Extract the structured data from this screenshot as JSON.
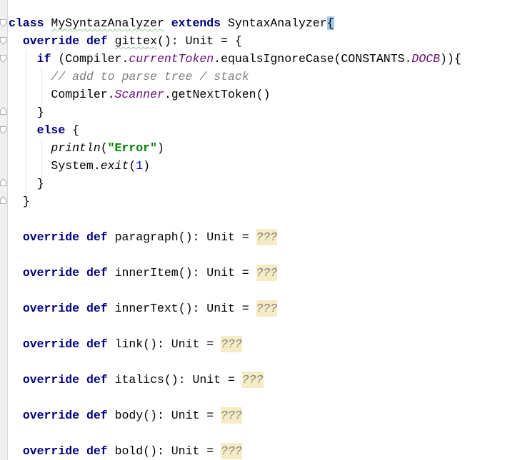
{
  "editor": {
    "class_decl": {
      "kw_class": "class",
      "name": "MySyntazAnalyzer",
      "kw_extends": "extends",
      "parent": "SyntaxAnalyzer",
      "open_brace": "{"
    },
    "gittex": {
      "kw_override": "override",
      "kw_def": "def",
      "name": "gittex",
      "signature": "(): Unit = {"
    },
    "if_line": {
      "kw_if": "if",
      "part1": " (Compiler.",
      "field": "currentToken",
      "part2": ".equalsIgnoreCase(CONSTANTS.",
      "const": "DOCB",
      "part3": ")){"
    },
    "comment": "// add to parse tree / stack",
    "scanner_line": {
      "part1": "Compiler.",
      "field": "Scanner",
      "part2": ".getNextToken()"
    },
    "close_brace": "}",
    "else_line": {
      "kw_else": "else",
      "rest": " {"
    },
    "println_line": {
      "fn": "println",
      "open": "(",
      "str": "\"Error\"",
      "close": ")"
    },
    "exit_line": {
      "part1": "System.",
      "fn": "exit",
      "open": "(",
      "num": "1",
      "close": ")"
    },
    "methods": [
      {
        "kw_override": "override",
        "kw_def": "def",
        "name": "paragraph",
        "signature": "(): Unit = ",
        "body": "???"
      },
      {
        "kw_override": "override",
        "kw_def": "def",
        "name": "innerItem",
        "signature": "(): Unit = ",
        "body": "???"
      },
      {
        "kw_override": "override",
        "kw_def": "def",
        "name": "innerText",
        "signature": "(): Unit = ",
        "body": "???"
      },
      {
        "kw_override": "override",
        "kw_def": "def",
        "name": "link",
        "signature": "(): Unit = ",
        "body": "???"
      },
      {
        "kw_override": "override",
        "kw_def": "def",
        "name": "italics",
        "signature": "(): Unit = ",
        "body": "???"
      },
      {
        "kw_override": "override",
        "kw_def": "def",
        "name": "body",
        "signature": "(): Unit = ",
        "body": "???"
      },
      {
        "kw_override": "override",
        "kw_def": "def",
        "name": "bold",
        "signature": "(): Unit = ",
        "body": "???"
      }
    ]
  }
}
